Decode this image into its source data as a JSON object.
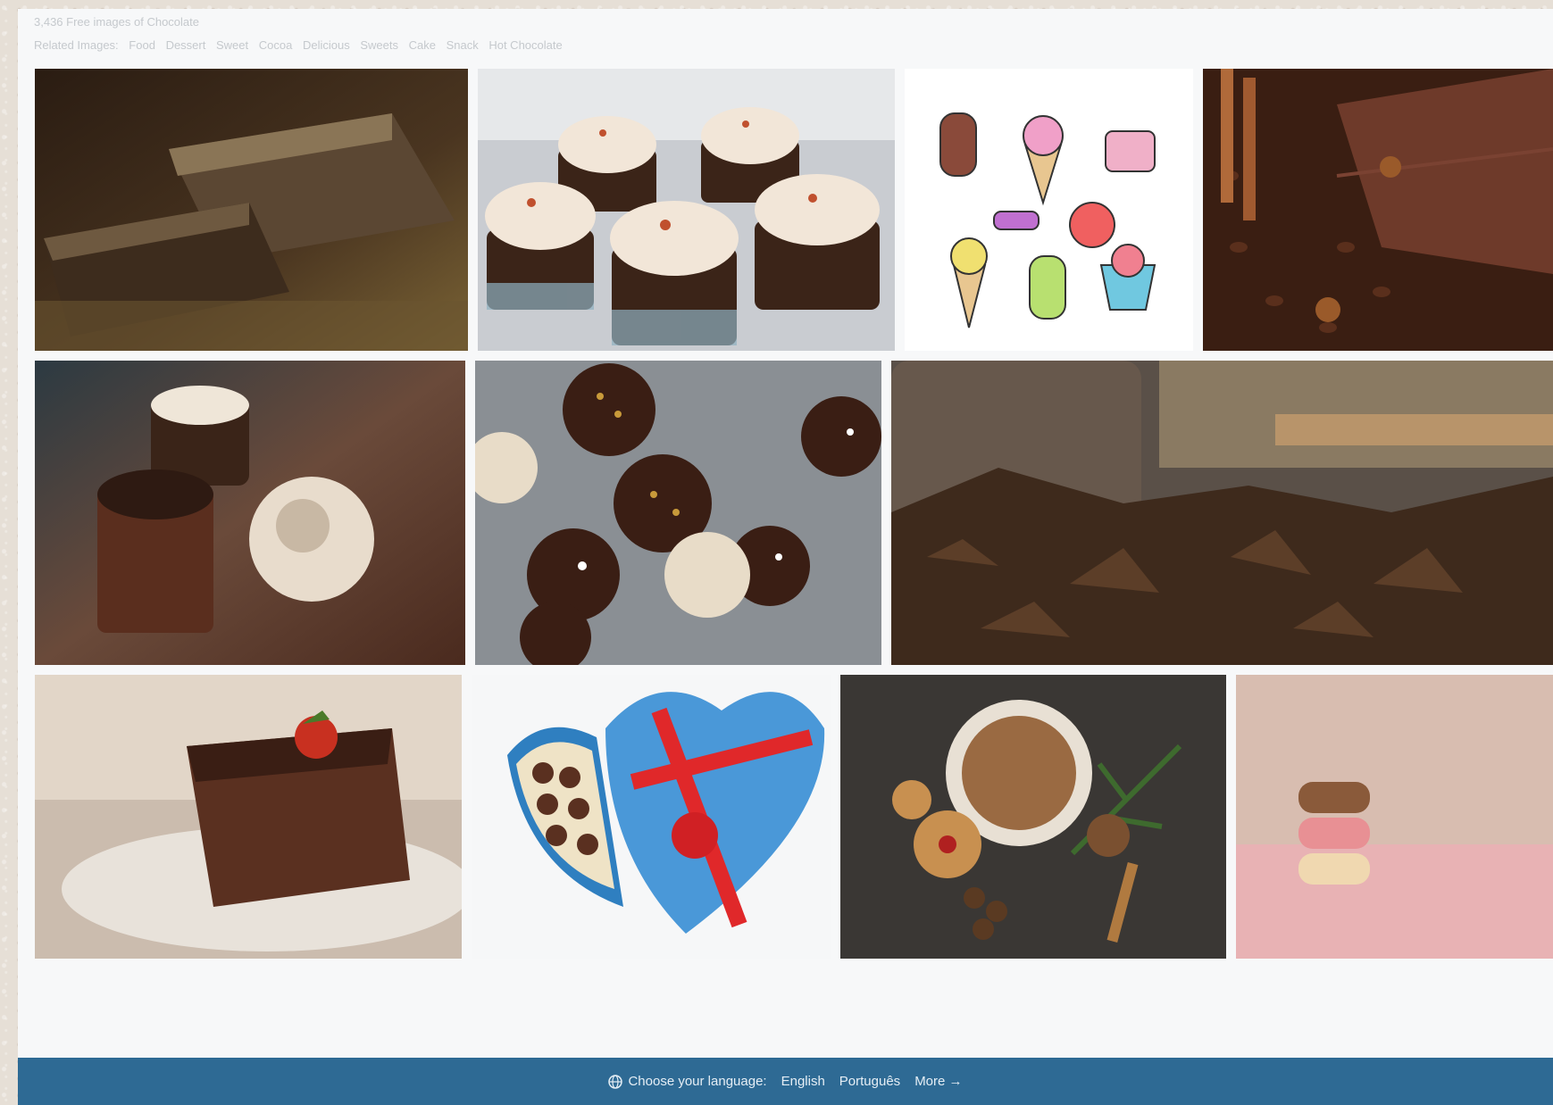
{
  "header": {
    "count_text": "3,436 Free images of Chocolate",
    "related_label": "Related Images:",
    "related": [
      "Food",
      "Dessert",
      "Sweet",
      "Cocoa",
      "Delicious",
      "Sweets",
      "Cake",
      "Snack",
      "Hot Chocolate"
    ]
  },
  "images": [
    {
      "name": "image-chocolate-bars",
      "subject": "Chocolate bars"
    },
    {
      "name": "image-cupcakes",
      "subject": "Cupcakes"
    },
    {
      "name": "image-sweets-illustration",
      "subject": "Ice cream and candy illustration"
    },
    {
      "name": "image-chocolate-coffee-beans",
      "subject": "Chocolate with coffee beans and star anise"
    },
    {
      "name": "image-truffles",
      "subject": "Chocolate truffles"
    },
    {
      "name": "image-cake-pops",
      "subject": "Cake pops"
    },
    {
      "name": "image-chocolate-shavings-jar",
      "subject": "Chocolate shavings in a jar"
    },
    {
      "name": "image-chocolate-cake-slice",
      "subject": "Chocolate cake slice with strawberry"
    },
    {
      "name": "image-heart-chocolate-box",
      "subject": "Heart shaped chocolate box"
    },
    {
      "name": "image-hot-chocolate-cookies",
      "subject": "Hot chocolate with cookies"
    },
    {
      "name": "image-macarons",
      "subject": "Stack of macarons"
    }
  ],
  "footer": {
    "choose_label": "Choose your language:",
    "languages": [
      "English",
      "Português"
    ],
    "more_label": "More →"
  }
}
